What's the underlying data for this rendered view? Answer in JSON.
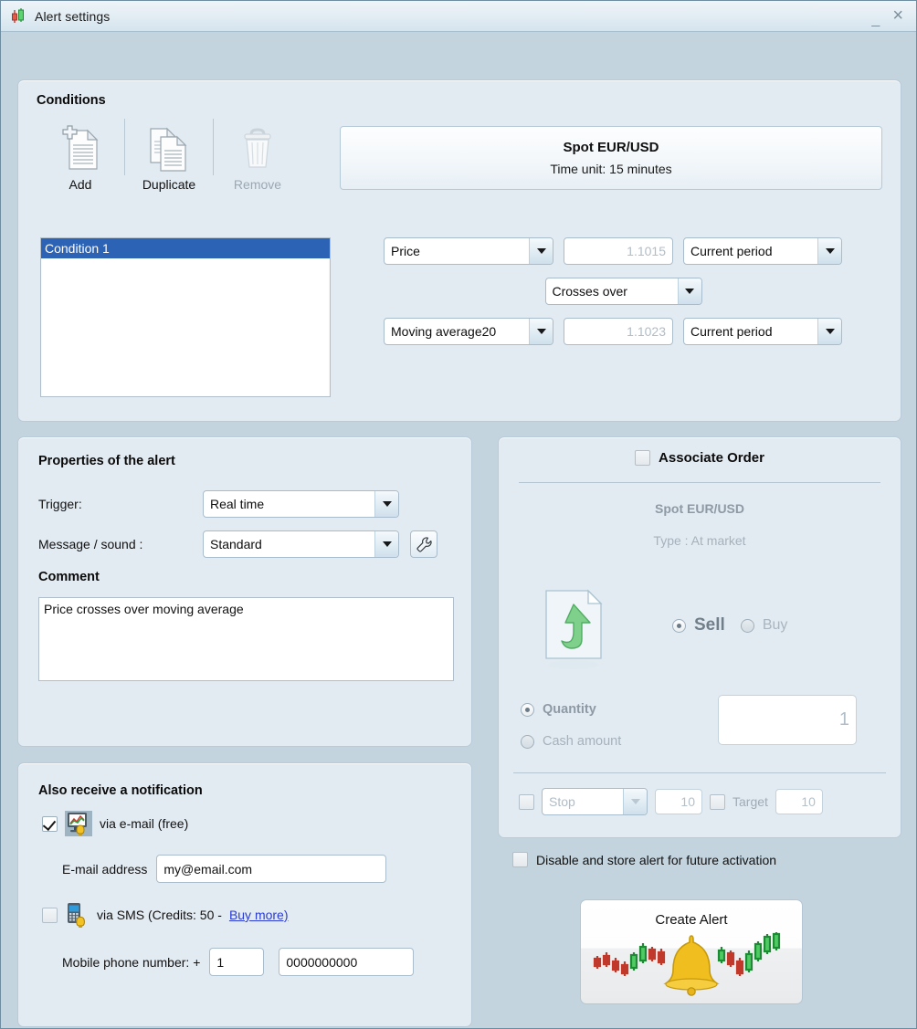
{
  "window": {
    "title": "Alert settings",
    "icon": "candlestick-icon",
    "minimize_label": "_",
    "close_label": "×"
  },
  "conditions": {
    "title": "Conditions",
    "toolbar": [
      {
        "label": "Add",
        "icon": "add-document-icon",
        "enabled": true
      },
      {
        "label": "Duplicate",
        "icon": "duplicate-document-icon",
        "enabled": true
      },
      {
        "label": "Remove",
        "icon": "trash-icon",
        "enabled": false
      }
    ],
    "instrument": {
      "name": "Spot EUR/USD",
      "time_unit": "Time unit:  15 minutes"
    },
    "list": [
      {
        "label": "Condition 1",
        "selected": true
      }
    ],
    "expression": {
      "left_operand": "Price",
      "left_value": "1.1015",
      "left_period": "Current period",
      "operator": "Crosses over",
      "right_operand": "Moving average20",
      "right_value": "1.1023",
      "right_period": "Current period"
    }
  },
  "properties": {
    "title": "Properties of the alert",
    "trigger_label": "Trigger:",
    "trigger_value": "Real time",
    "message_label": "Message / sound :",
    "message_value": "Standard",
    "settings_icon": "wrench-icon",
    "comment_label": "Comment",
    "comment_value": "Price crosses over moving average"
  },
  "notification": {
    "title": "Also receive a notification",
    "email": {
      "checked": true,
      "icon": "email-alert-icon",
      "label": "via e-mail (free)",
      "address_label": "E-mail address",
      "address_value": "my@email.com"
    },
    "sms": {
      "checked": false,
      "icon": "sms-alert-icon",
      "label_prefix": "via SMS  (Credits:  50  -  ",
      "buy_link": "Buy more)",
      "phone_label": "Mobile phone number: +",
      "country_code": "1",
      "phone_number": "0000000000"
    }
  },
  "order": {
    "checkbox_checked": false,
    "title": "Associate Order",
    "instrument": "Spot EUR/USD",
    "type": "Type : At market",
    "direction_icon": "green-up-arrow-document-icon",
    "sell_label": "Sell",
    "sell_selected": true,
    "buy_label": "Buy",
    "buy_selected": false,
    "quantity_label": "Quantity",
    "quantity_selected": true,
    "cash_label": "Cash amount",
    "cash_selected": false,
    "quantity_value": "1",
    "stop_checked": false,
    "stop_label": "Stop",
    "stop_value": "10",
    "target_checked": false,
    "target_label": "Target",
    "target_value": "10"
  },
  "footer": {
    "disable_checked": false,
    "disable_label": "Disable and store alert for future activation",
    "create_label": "Create Alert",
    "create_icon": "bell-chart-icon"
  },
  "colors": {
    "window_bg": "#c3d4df",
    "panel_bg": "#e3ebf2",
    "selection_blue": "#2c63b4",
    "link_blue": "#2a3bd1",
    "disabled_grey": "#a5b1bb"
  }
}
